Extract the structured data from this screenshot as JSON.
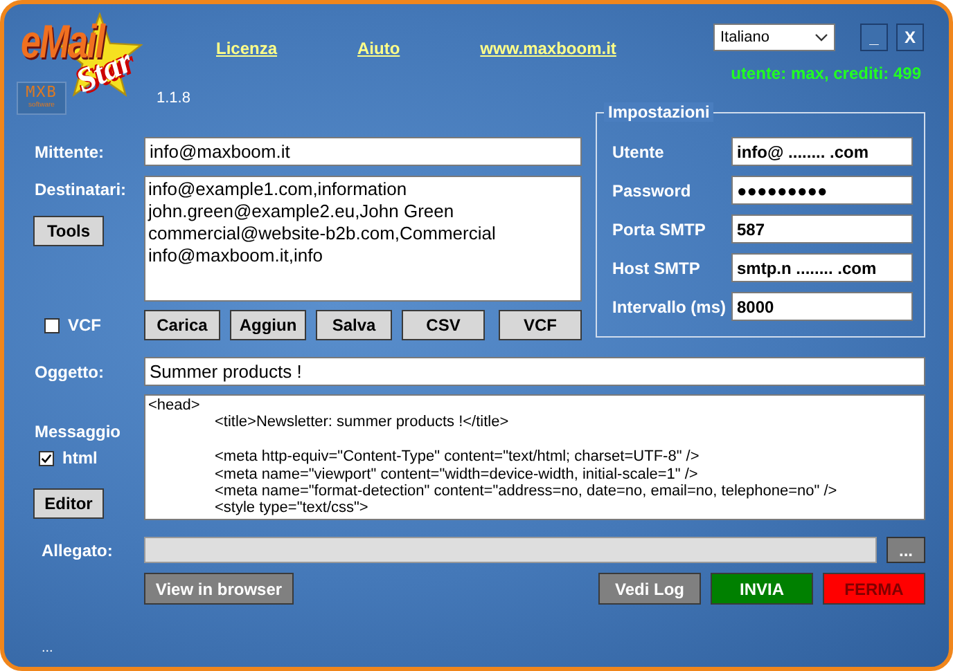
{
  "logo": {
    "word_top": "eMail",
    "word_bottom": "Star",
    "badge": "MXB",
    "badge_sub": "software"
  },
  "version": "1.1.8",
  "links": [
    "Licenza",
    "Aiuto",
    "www.maxboom.it"
  ],
  "language": {
    "value": "Italiano"
  },
  "window_buttons": [
    "_",
    "X"
  ],
  "credits": "utente: max, crediti: 499",
  "sender": {
    "label": "Mittente:",
    "value": "info@maxboom.it"
  },
  "recipients": {
    "label": "Destinatari:",
    "value": "info@example1.com,information\njohn.green@example2.eu,John Green\ncommercial@website-b2b.com,Commercial\ninfo@maxboom.it,info"
  },
  "tools_button": "Tools",
  "vcf_checkbox": {
    "label": "VCF",
    "checked": false
  },
  "list_buttons": [
    "Carica",
    "Aggiun",
    "Salva",
    "CSV",
    "VCF"
  ],
  "settings": {
    "title": "Impostazioni",
    "fields": [
      {
        "label": "Utente",
        "value": "info@ ........ .com"
      },
      {
        "label": "Password",
        "value": "●●●●●●●●●"
      },
      {
        "label": "Porta SMTP",
        "value": "587"
      },
      {
        "label": "Host SMTP",
        "value": "smtp.n ........ .com"
      },
      {
        "label": "Intervallo (ms)",
        "value": "8000"
      }
    ]
  },
  "subject": {
    "label": "Oggetto:",
    "value": "Summer products !"
  },
  "message": {
    "label": "Messaggio",
    "value": "<head>\n\t<title>Newsletter: summer products !</title>\n\n\t<meta http-equiv=\"Content-Type\" content=\"text/html; charset=UTF-8\" />\n\t<meta name=\"viewport\" content=\"width=device-width, initial-scale=1\" />\n\t<meta name=\"format-detection\" content=\"address=no, date=no, email=no, telephone=no\" />\n\t<style type=\"text/css\">"
  },
  "html_checkbox": {
    "label": "html",
    "checked": true
  },
  "editor_button": "Editor",
  "attachment": {
    "label": "Allegato:",
    "browse": "..."
  },
  "actions": [
    {
      "label": "View in browser",
      "kind": "neutral"
    },
    {
      "label": "Vedi Log",
      "kind": "neutral"
    },
    {
      "label": "INVIA",
      "kind": "send"
    },
    {
      "label": "FERMA",
      "kind": "stop"
    }
  ],
  "status": "..."
}
